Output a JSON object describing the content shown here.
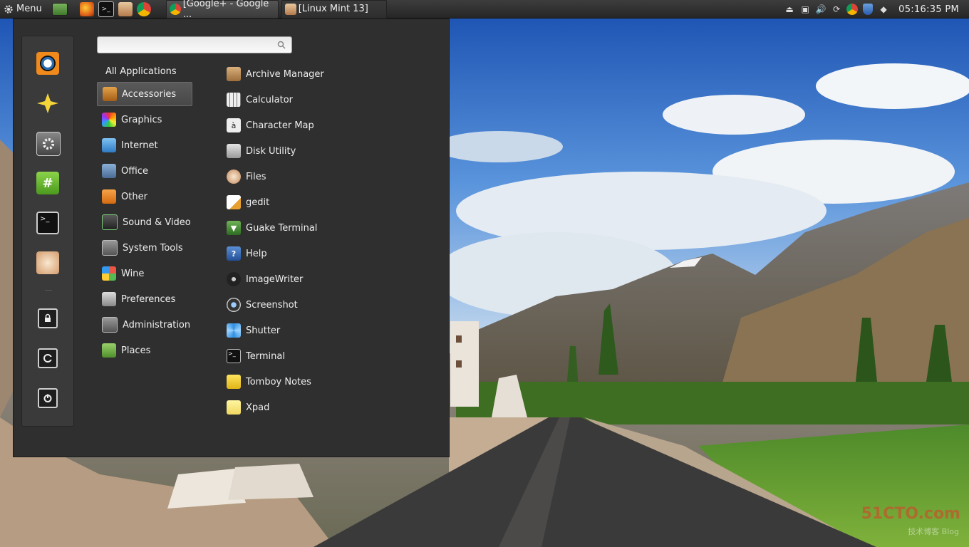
{
  "panel": {
    "menu_label": "Menu",
    "tasks": [
      {
        "label": "[Google+ - Google ...",
        "state": "active"
      },
      {
        "label": "[Linux Mint 13]",
        "state": "inactive"
      }
    ],
    "clock": "05:16:35 PM"
  },
  "menu": {
    "search": {
      "value": "",
      "placeholder": ""
    },
    "all_applications_label": "All Applications",
    "categories": [
      {
        "label": "Accessories",
        "icon": "accessories-icon",
        "selected": true
      },
      {
        "label": "Graphics",
        "icon": "graphics-icon"
      },
      {
        "label": "Internet",
        "icon": "internet-icon"
      },
      {
        "label": "Office",
        "icon": "office-icon"
      },
      {
        "label": "Other",
        "icon": "other-icon"
      },
      {
        "label": "Sound & Video",
        "icon": "sound-video-icon"
      },
      {
        "label": "System Tools",
        "icon": "system-tools-icon"
      },
      {
        "label": "Wine",
        "icon": "wine-icon"
      },
      {
        "label": "Preferences",
        "icon": "preferences-icon"
      },
      {
        "label": "Administration",
        "icon": "administration-icon"
      },
      {
        "label": "Places",
        "icon": "folder-icon"
      }
    ],
    "apps": [
      {
        "label": "Archive Manager",
        "icon": "archive-icon"
      },
      {
        "label": "Calculator",
        "icon": "calculator-icon"
      },
      {
        "label": "Character Map",
        "icon": "character-map-icon"
      },
      {
        "label": "Disk Utility",
        "icon": "disk-utility-icon"
      },
      {
        "label": "Files",
        "icon": "files-icon"
      },
      {
        "label": "gedit",
        "icon": "gedit-icon"
      },
      {
        "label": "Guake Terminal",
        "icon": "guake-icon"
      },
      {
        "label": "Help",
        "icon": "help-icon"
      },
      {
        "label": "ImageWriter",
        "icon": "imagewriter-icon"
      },
      {
        "label": "Screenshot",
        "icon": "screenshot-icon"
      },
      {
        "label": "Shutter",
        "icon": "shutter-icon"
      },
      {
        "label": "Terminal",
        "icon": "terminal-icon"
      },
      {
        "label": "Tomboy Notes",
        "icon": "tomboy-icon"
      },
      {
        "label": "Xpad",
        "icon": "xpad-icon"
      }
    ]
  },
  "watermark": {
    "text": "51CTO.com",
    "sub": "技术博客  Blog"
  },
  "colors": {
    "menu_bg": "#2f2f2f",
    "panel_bg": "#2e2e2e",
    "selection": "#555555"
  }
}
